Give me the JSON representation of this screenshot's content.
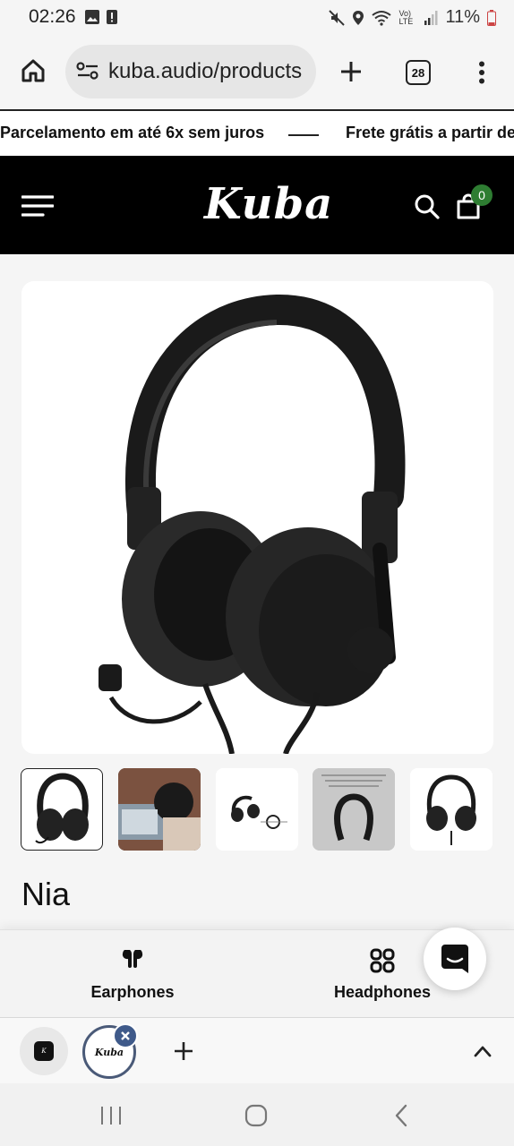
{
  "status_bar": {
    "time": "02:26",
    "battery": "11%",
    "network_label": "Vo) LTE"
  },
  "browser": {
    "url": "kuba.audio/products",
    "tab_count": "28",
    "icons": [
      "home-icon",
      "site-settings-icon",
      "new-tab-icon",
      "tab-switcher-icon",
      "more-menu-icon"
    ]
  },
  "announcement": {
    "items": [
      "Parcelamento em até 6x sem juros",
      "Frete grátis a partir de"
    ]
  },
  "header": {
    "logo": "Kuba",
    "cart_count": "0",
    "colors": {
      "background": "#000000",
      "badge": "#2e7d32"
    }
  },
  "product": {
    "name": "Nia",
    "thumbnails": [
      "headphone-front",
      "person-using-headset",
      "headphone-accessories",
      "headband-detail",
      "headphone-frontal"
    ]
  },
  "bottom_nav": {
    "items": [
      {
        "label": "Earphones",
        "icon": "earphones-icon"
      },
      {
        "label": "Headphones",
        "icon": "grid-icon"
      }
    ]
  },
  "tab_strip": {
    "tabs": [
      "kuba-tab-1",
      "kuba-tab-2"
    ]
  }
}
